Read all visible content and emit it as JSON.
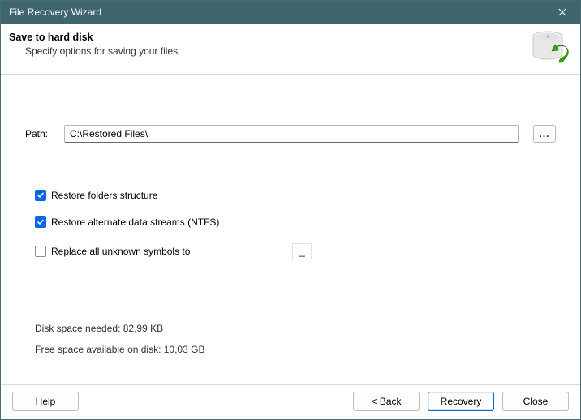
{
  "window": {
    "title": "File Recovery Wizard"
  },
  "header": {
    "title": "Save to hard disk",
    "subtitle": "Specify options for saving your files"
  },
  "path": {
    "label": "Path:",
    "value": "C:\\Restored Files\\",
    "browse_label": "..."
  },
  "options": {
    "restore_folders": {
      "label": "Restore folders structure",
      "checked": true
    },
    "restore_ads": {
      "label": "Restore alternate data streams (NTFS)",
      "checked": true
    },
    "replace_unknown": {
      "label": "Replace all unknown symbols to",
      "checked": false,
      "value": "_"
    }
  },
  "disk": {
    "needed_label": "Disk space needed: 82,99 KB",
    "free_label": "Free space available on disk: 10,03 GB"
  },
  "footer": {
    "help": "Help",
    "back": "< Back",
    "recovery": "Recovery",
    "close": "Close"
  }
}
